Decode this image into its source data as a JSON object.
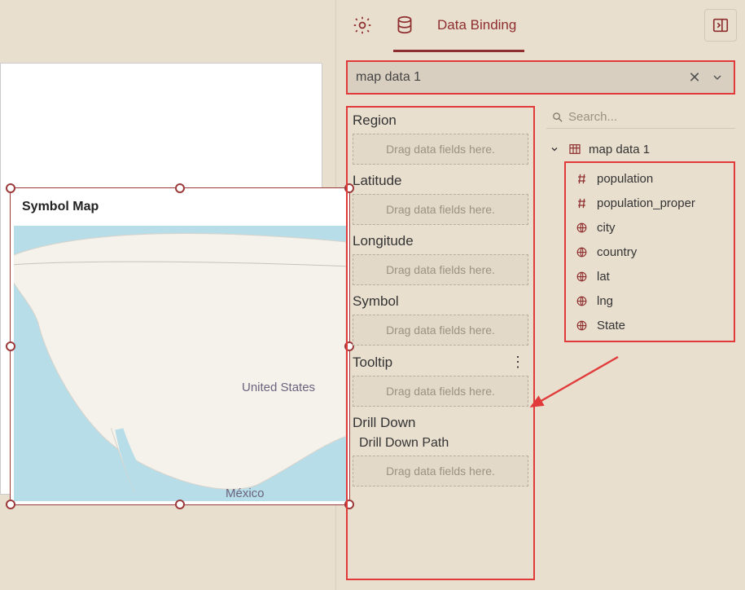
{
  "tabs": {
    "settings_tooltip": "Settings",
    "data_binding_label": "Data Binding"
  },
  "datasource": {
    "selected": "map data 1"
  },
  "search": {
    "placeholder": "Search..."
  },
  "zones": [
    {
      "label": "Region",
      "placeholder": "Drag data fields here."
    },
    {
      "label": "Latitude",
      "placeholder": "Drag data fields here."
    },
    {
      "label": "Longitude",
      "placeholder": "Drag data fields here."
    },
    {
      "label": "Symbol",
      "placeholder": "Drag data fields here."
    },
    {
      "label": "Tooltip",
      "placeholder": "Drag data fields here.",
      "has_more": true
    }
  ],
  "drilldown": {
    "label": "Drill Down",
    "sublabel": "Drill Down Path",
    "placeholder": "Drag data fields here."
  },
  "tree": {
    "root_label": "map data 1",
    "fields": [
      {
        "icon": "number",
        "label": "population"
      },
      {
        "icon": "number",
        "label": "population_proper"
      },
      {
        "icon": "globe",
        "label": "city"
      },
      {
        "icon": "globe",
        "label": "country"
      },
      {
        "icon": "globe",
        "label": "lat"
      },
      {
        "icon": "globe",
        "label": "lng"
      },
      {
        "icon": "globe",
        "label": "State"
      }
    ]
  },
  "widget": {
    "title": "Symbol Map",
    "map_labels": {
      "us": "United States",
      "mx": "México"
    }
  }
}
